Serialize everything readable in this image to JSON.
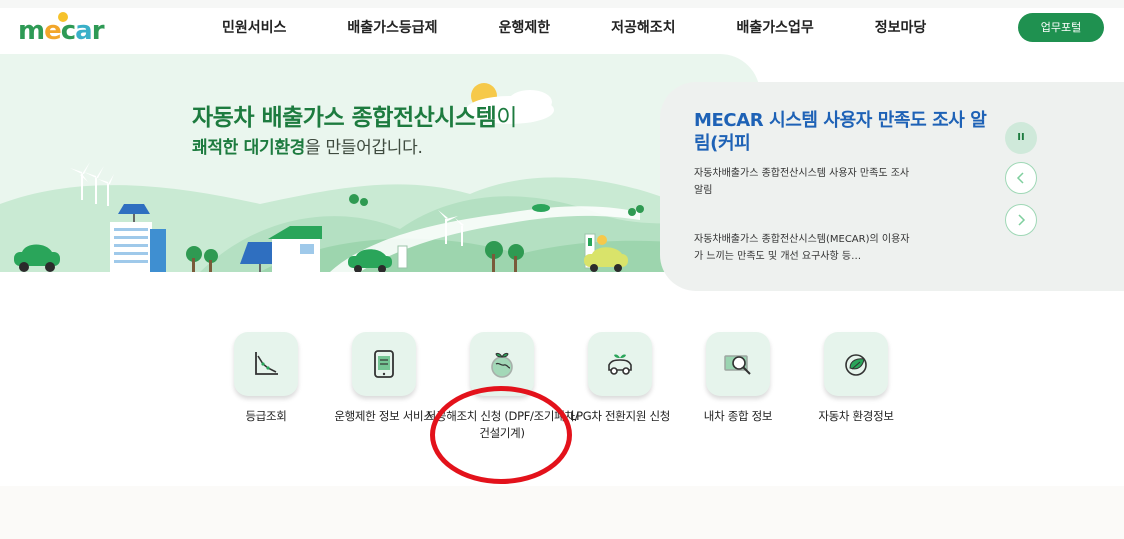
{
  "header": {
    "logo_text": "mecar",
    "nav": [
      "민원서비스",
      "배출가스등급제",
      "운행제한",
      "저공해조치",
      "배출가스업무",
      "정보마당"
    ],
    "portal_button": "업무포털"
  },
  "hero": {
    "title_bold": "자동차 배출가스 종합전산시스템",
    "title_tail": "이",
    "sub_bold": "쾌적한 대기환경",
    "sub_tail": "을 만들어갑니다."
  },
  "notice": {
    "title": "MECAR 시스템 사용자 만족도 조사 알림(커피",
    "summary": "자동차배출가스 종합전산시스템 사용자 만족도 조사 알림",
    "body": "자동차배출가스 종합전산시스템(MECAR)의 이용자가 느끼는 만족도 및 개선 요구사항 등…",
    "pause_label": "II"
  },
  "quick_menu": [
    {
      "label": "등급조회",
      "icon": "chart-icon"
    },
    {
      "label": "운행제한 정보 서비스",
      "icon": "tablet-icon"
    },
    {
      "label": "저공해조치 신청 (DPF/조기폐차/ 건설기계)",
      "icon": "globe-plant-icon"
    },
    {
      "label": "LPG차 전환지원 신청",
      "icon": "eco-car-icon"
    },
    {
      "label": "내차 종합 정보",
      "icon": "money-search-icon"
    },
    {
      "label": "자동차 환경정보",
      "icon": "leaf-badge-icon"
    }
  ],
  "colors": {
    "brand_green": "#1f9150",
    "hero_bg": "#eaf6ee",
    "notice_title": "#1e62b6",
    "annotation_red": "#e3121b"
  }
}
